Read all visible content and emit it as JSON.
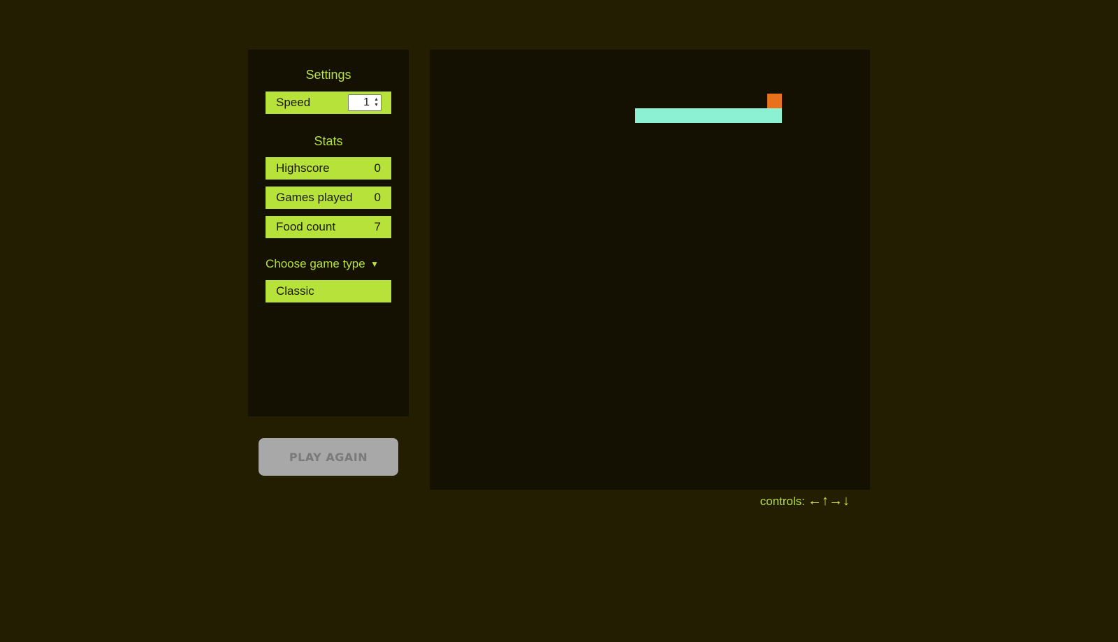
{
  "settings": {
    "title": "Settings",
    "speed_label": "Speed",
    "speed_value": "1"
  },
  "stats": {
    "title": "Stats",
    "items": [
      {
        "label": "Highscore",
        "value": "0"
      },
      {
        "label": "Games played",
        "value": "0"
      },
      {
        "label": "Food count",
        "value": "7"
      }
    ]
  },
  "game_type": {
    "label": "Choose game type",
    "selected": "Classic"
  },
  "play_again_label": "PLAY AGAIN",
  "controls": {
    "label": "controls:",
    "arrows": [
      "←",
      "↑",
      "→",
      "↓"
    ]
  },
  "colors": {
    "page_background": "#231e02",
    "panel_background": "#141102",
    "accent": "#b6e23a",
    "snake": "#8cf0d2",
    "food": "#e8711c",
    "button": "#a8a8a8"
  },
  "icons": {
    "dropdown": "caret-down-icon",
    "spinner": "up-down-spinner-icon"
  }
}
